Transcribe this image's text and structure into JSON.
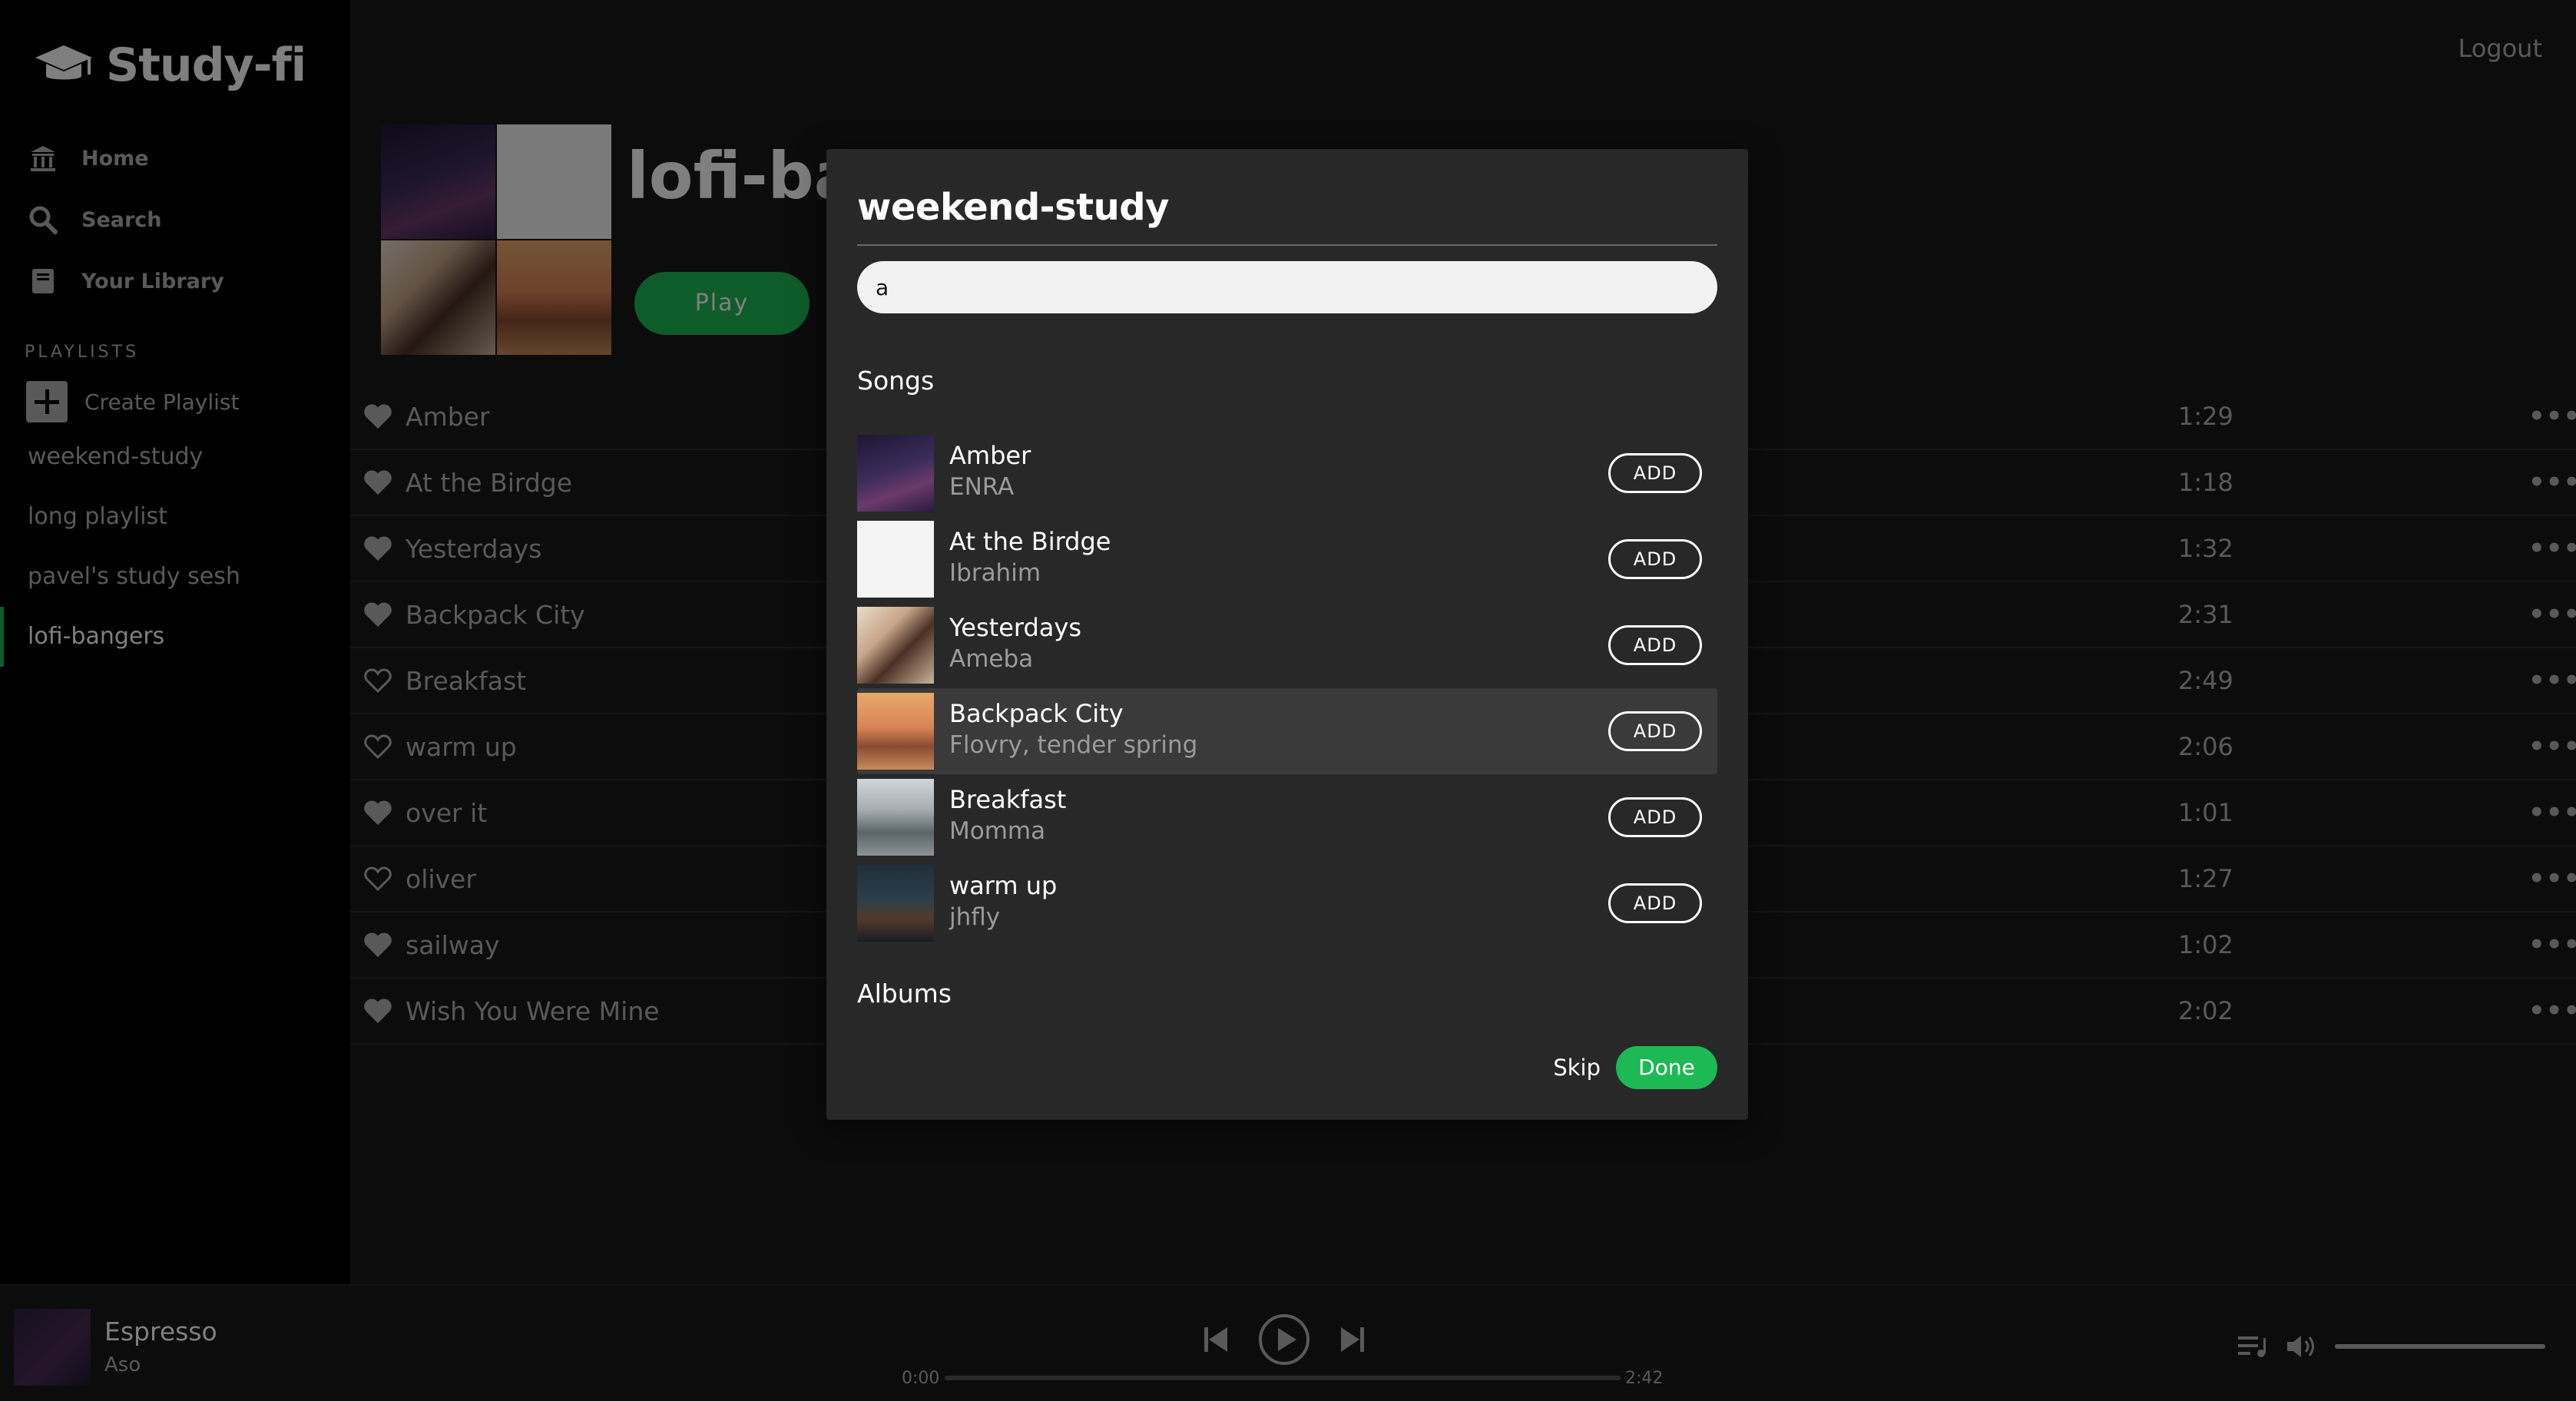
{
  "brand": {
    "name": "Study-fi"
  },
  "nav": {
    "items": [
      {
        "label": "Home",
        "icon": "home-icon"
      },
      {
        "label": "Search",
        "icon": "search-icon"
      },
      {
        "label": "Your Library",
        "icon": "library-icon"
      }
    ]
  },
  "sidebar": {
    "playlists_heading": "PLAYLISTS",
    "create_playlist": "Create Playlist",
    "playlists": [
      "weekend-study",
      "long playlist",
      "pavel's study sesh",
      "lofi-bangers"
    ],
    "active_playlist": "lofi-bangers"
  },
  "header": {
    "logout": "Logout"
  },
  "playlist_view": {
    "title": "lofi-bangers",
    "play_label": "Play",
    "tracks": [
      {
        "name": "Amber",
        "duration": "1:29",
        "liked": true
      },
      {
        "name": "At the Birdge",
        "duration": "1:18",
        "liked": true
      },
      {
        "name": "Yesterdays",
        "duration": "1:32",
        "liked": true
      },
      {
        "name": "Backpack City",
        "duration": "2:31",
        "liked": true
      },
      {
        "name": "Breakfast",
        "duration": "2:49",
        "liked": false
      },
      {
        "name": "warm up",
        "duration": "2:06",
        "liked": false
      },
      {
        "name": "over it",
        "duration": "1:01",
        "liked": true
      },
      {
        "name": "oliver",
        "duration": "1:27",
        "liked": false
      },
      {
        "name": "sailway",
        "duration": "1:02",
        "liked": true
      },
      {
        "name": "Wish You Were Mine",
        "duration": "2:02",
        "liked": true
      }
    ],
    "more_label": "•••"
  },
  "modal": {
    "title": "weekend-study",
    "search_value": "a",
    "songs_heading": "Songs",
    "albums_heading": "Albums",
    "add_label": "ADD",
    "songs": [
      {
        "title": "Amber",
        "artist": "ENRA"
      },
      {
        "title": "At the Birdge",
        "artist": "Ibrahim"
      },
      {
        "title": "Yesterdays",
        "artist": "Ameba"
      },
      {
        "title": "Backpack City",
        "artist": "Flovry, tender spring"
      },
      {
        "title": "Breakfast",
        "artist": "Momma"
      },
      {
        "title": "warm up",
        "artist": "jhfly"
      }
    ],
    "hovered_song": "Backpack City",
    "skip_label": "Skip",
    "done_label": "Done"
  },
  "player": {
    "now_playing_title": "Espresso",
    "now_playing_artist": "Aso",
    "elapsed": "0:00",
    "duration": "2:42",
    "progress": 0,
    "volume": 1.0
  },
  "colors": {
    "accent": "#1db954",
    "background": "#121212",
    "sidebar": "#000000",
    "modal": "#282828",
    "muted_text": "#b3b3b3"
  }
}
